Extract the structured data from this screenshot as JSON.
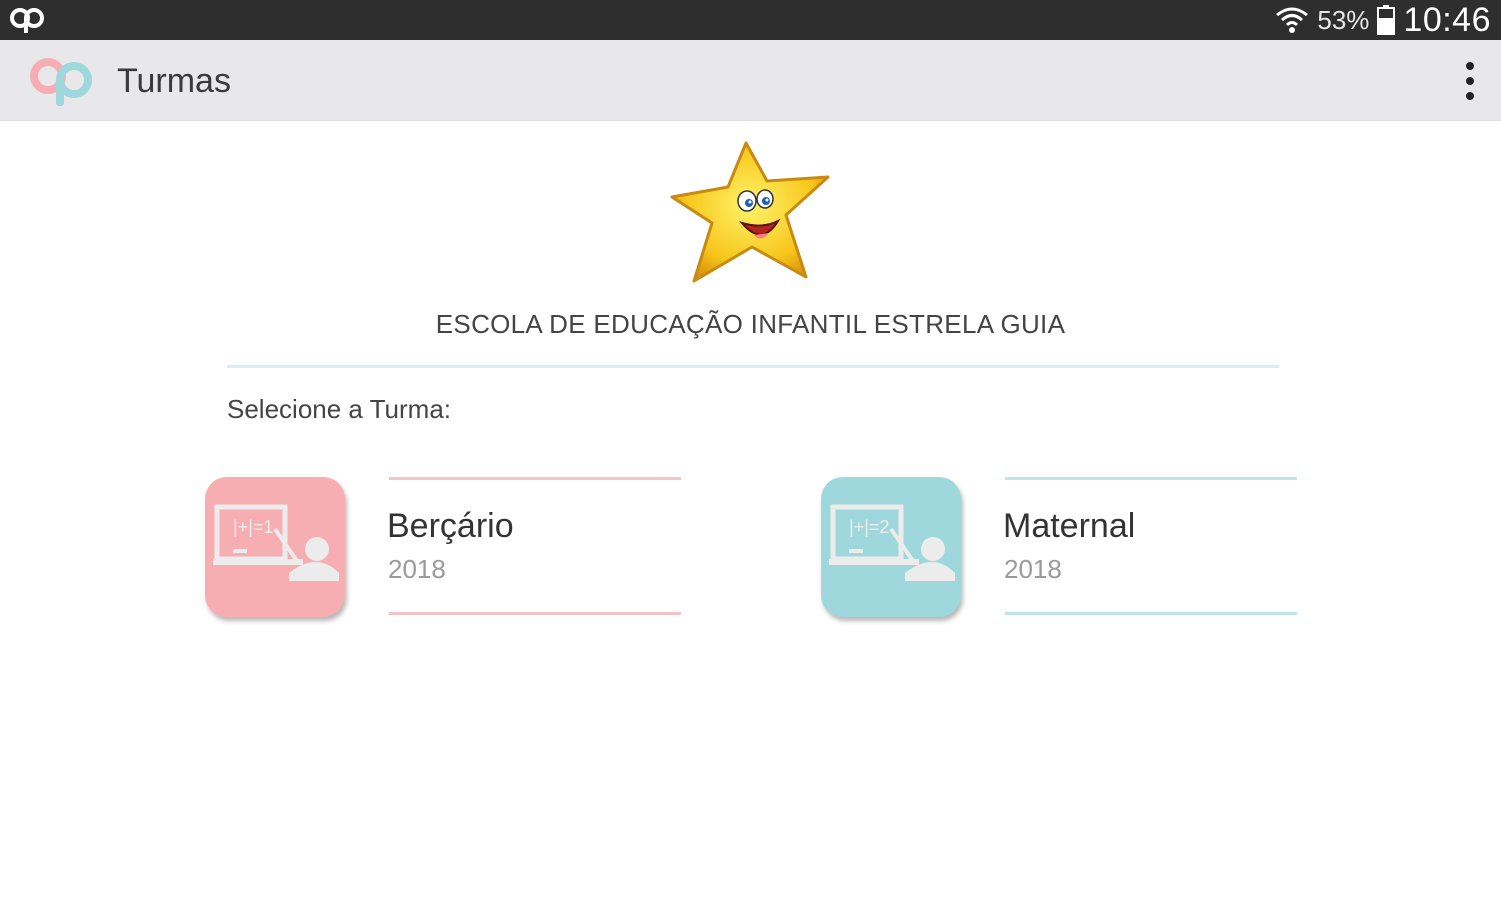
{
  "status_bar": {
    "battery_percent": "53%",
    "time": "10:46"
  },
  "app_bar": {
    "title": "Turmas"
  },
  "school": {
    "name": "ESCOLA DE EDUCAÇÃO INFANTIL ESTRELA GUIA"
  },
  "prompt": "Selecione a Turma:",
  "classes": [
    {
      "name": "Berçário",
      "year": "2018",
      "board_text": "|+|=1",
      "color": "#f6aeb3",
      "line_color": "#f4c3c6"
    },
    {
      "name": "Maternal",
      "year": "2018",
      "board_text": "|+|=2",
      "color": "#9fd8dc",
      "line_color": "#bfe5e8"
    }
  ],
  "colors": {
    "status_bar": "#2e2e2e",
    "app_bar": "#e8e8ea",
    "accent_pink": "#f6aeb3",
    "accent_teal": "#9fd8dc"
  },
  "icons": [
    "app-logo-icon",
    "wifi-icon",
    "battery-icon",
    "overflow-menu-icon",
    "star-mascot-icon",
    "classroom-board-icon"
  ]
}
